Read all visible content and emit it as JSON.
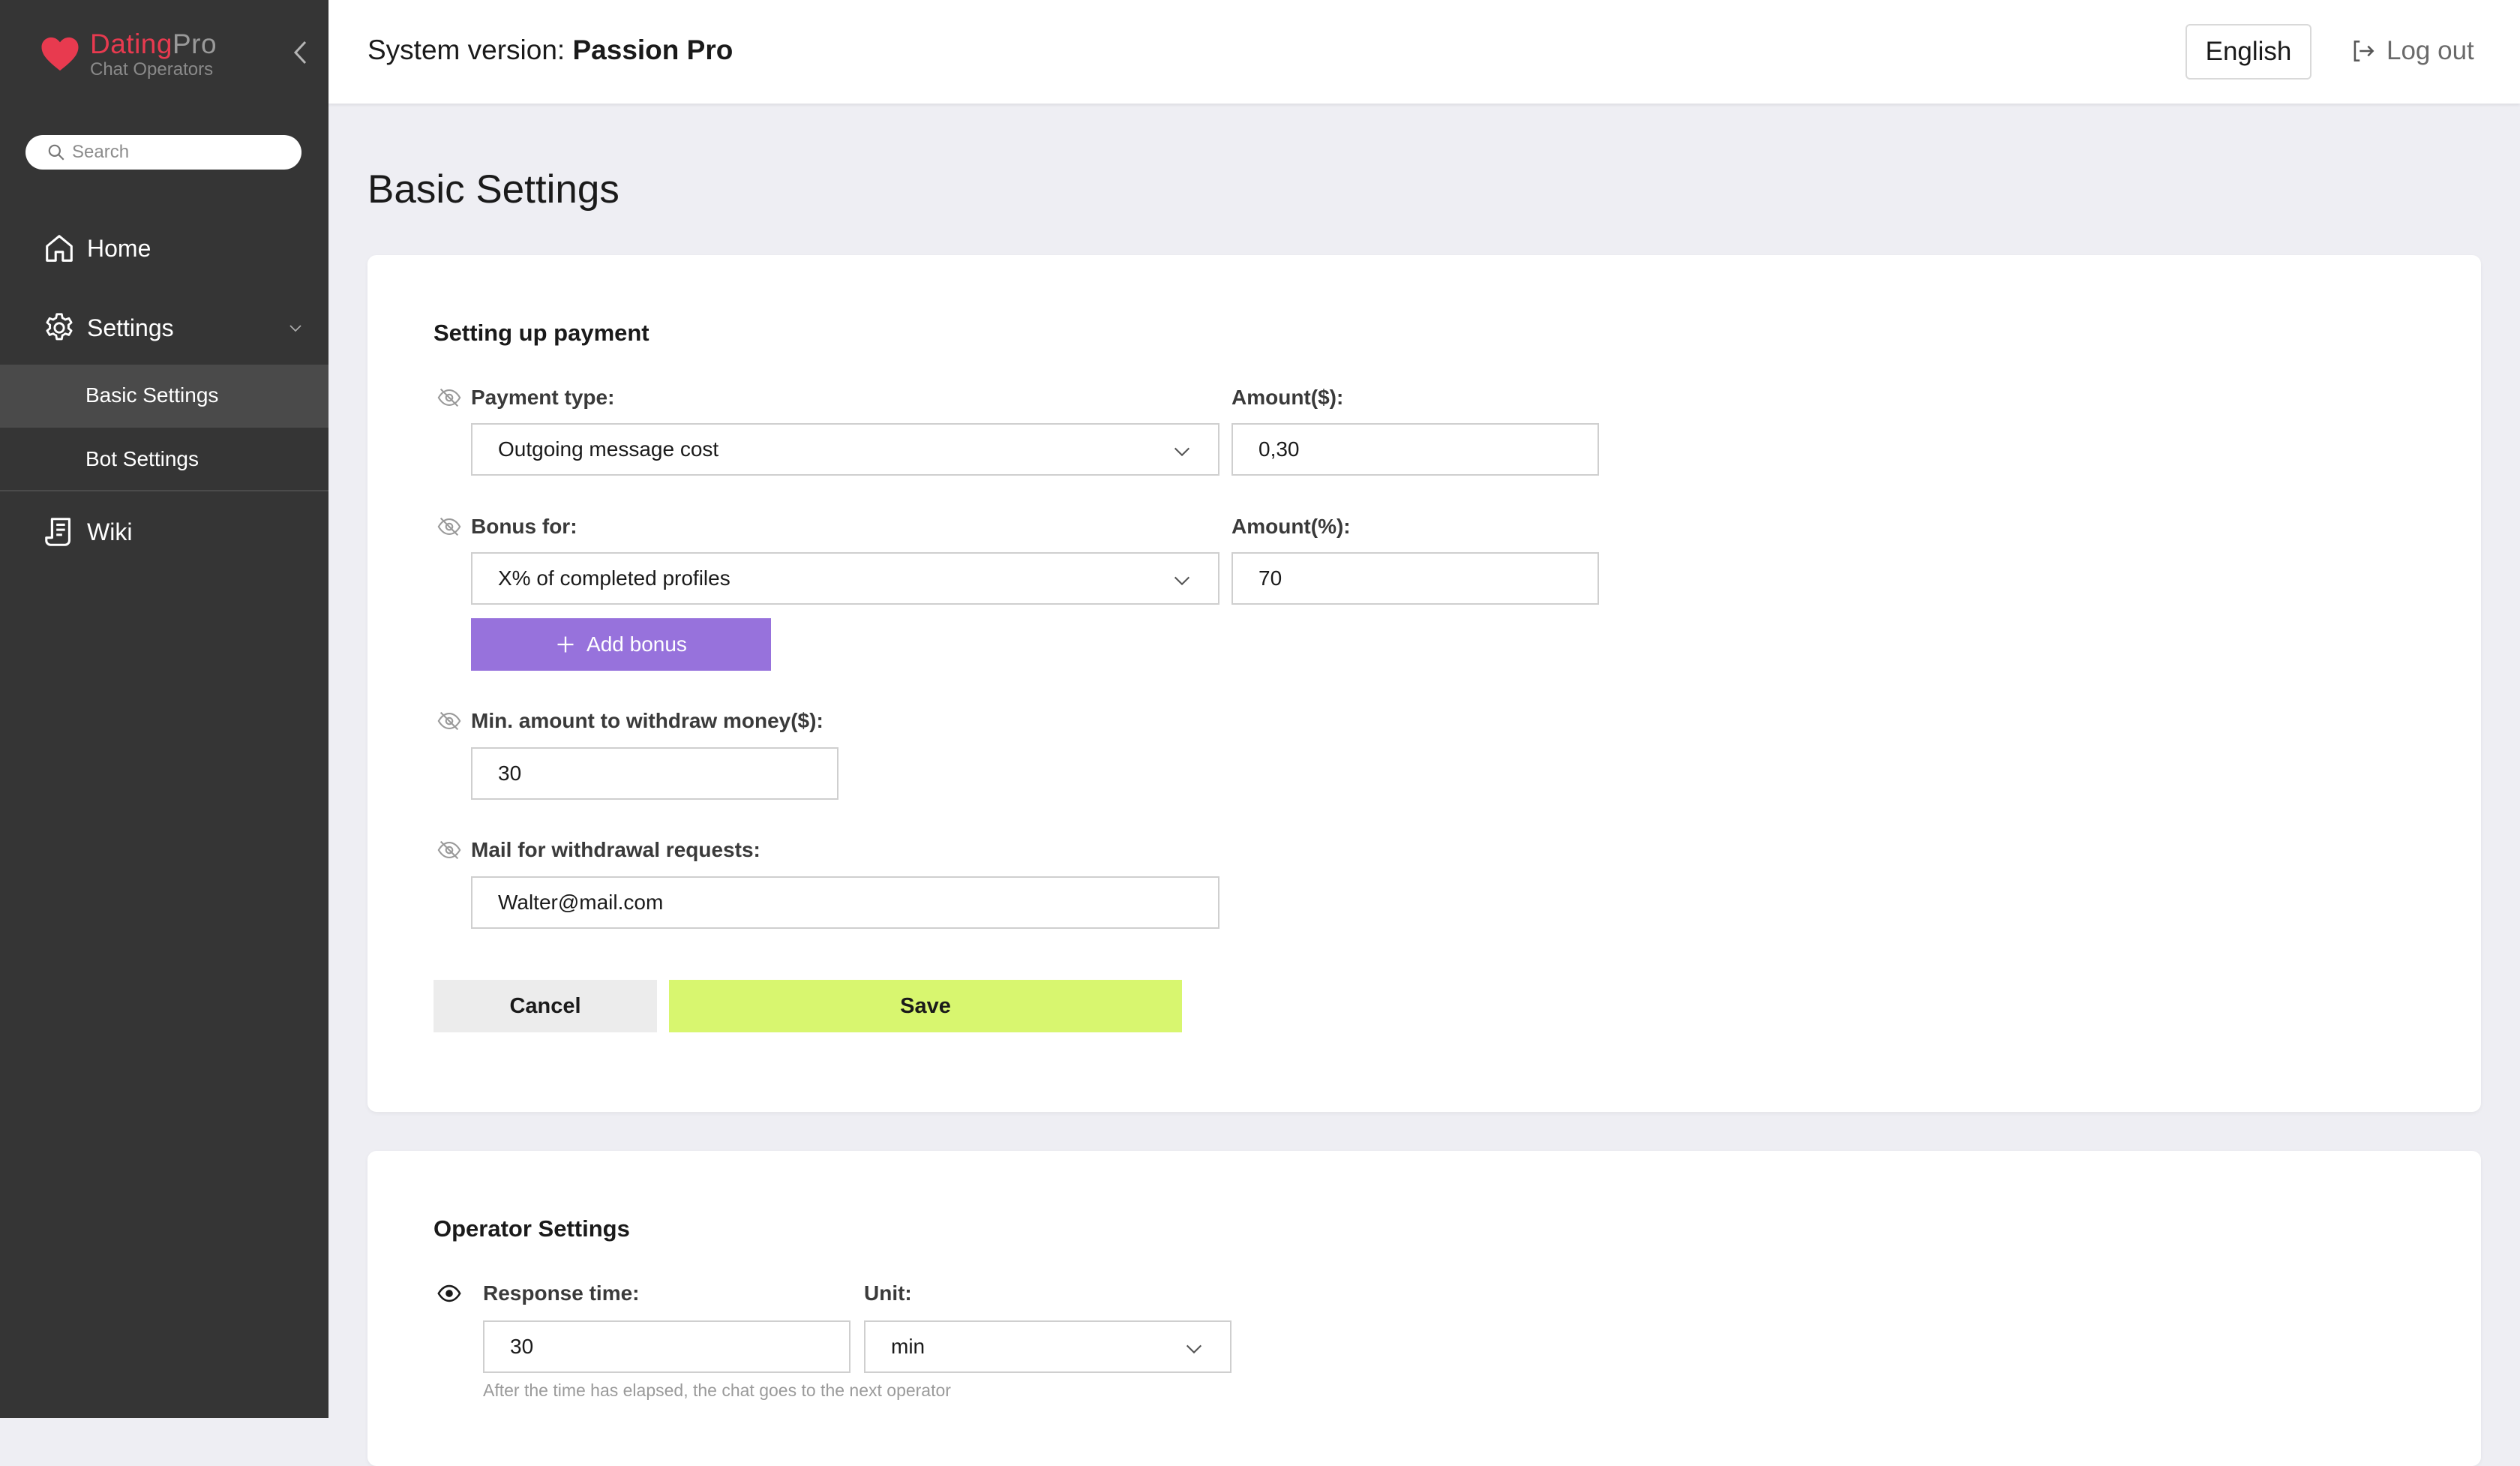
{
  "sidebar": {
    "logo": {
      "brand": "Dating",
      "brand_suffix": "Pro",
      "subtitle": "Chat Operators"
    },
    "search": {
      "placeholder": "Search",
      "value": ""
    },
    "nav": {
      "home": "Home",
      "settings": "Settings",
      "sub_items": [
        "Basic Settings",
        "Bot Settings"
      ],
      "wiki": "Wiki"
    }
  },
  "header": {
    "system_version_label": "System version:",
    "system_version_value": "Passion Pro",
    "language": "English",
    "logout": "Log out"
  },
  "page": {
    "title": "Basic Settings"
  },
  "payment": {
    "title": "Setting up payment",
    "payment_type_label": "Payment type:",
    "payment_type_value": "Outgoing message cost",
    "amount_usd_label": "Amount($):",
    "amount_usd_value": "0,30",
    "bonus_label": "Bonus for:",
    "bonus_value": "X% of completed profiles",
    "amount_pct_label": "Amount(%):",
    "amount_pct_value": "70",
    "add_bonus": "Add bonus",
    "min_withdraw_label": "Min. amount to withdraw money($):",
    "min_withdraw_value": "30",
    "mail_label": "Mail for withdrawal requests:",
    "mail_value": "Walter@mail.com",
    "cancel": "Cancel",
    "save": "Save"
  },
  "operator": {
    "title": "Operator Settings",
    "response_time_label": "Response time:",
    "response_time_value": "30",
    "unit_label": "Unit:",
    "unit_value": "min",
    "hint": "After the time has elapsed, the chat goes to the next operator"
  },
  "colors": {
    "sidebar_bg": "#353535",
    "brand_red": "#e83a4f",
    "add_bonus_purple": "#9772dc",
    "save_green": "#d8f66f",
    "page_bg": "#eeeef3"
  },
  "icons": {
    "logo": "heart-icon",
    "collapse": "chevron-left-icon",
    "search": "search-icon",
    "home": "home-icon",
    "settings": "gear-icon",
    "wiki": "document-icon",
    "logout": "logout-icon",
    "hidden_field": "eye-off-icon",
    "visible_field": "eye-icon"
  }
}
